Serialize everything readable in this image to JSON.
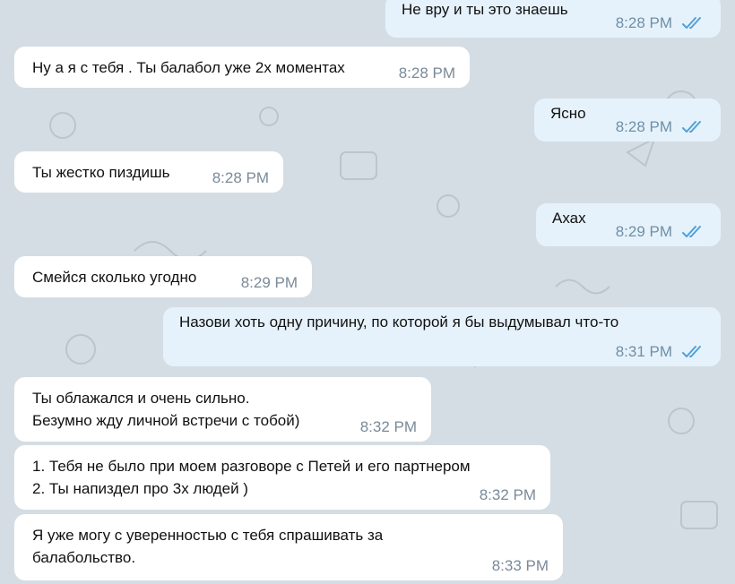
{
  "messages": [
    {
      "side": "out",
      "text": "Не вру и ты это знаешь",
      "time": "8:28 PM",
      "read": true
    },
    {
      "side": "in",
      "text": "Ну а я с тебя . Ты балабол уже 2х моментах",
      "time": "8:28 PM"
    },
    {
      "side": "out",
      "text": "Ясно",
      "time": "8:28 PM",
      "read": true
    },
    {
      "side": "in",
      "text": "Ты жестко пиздишь",
      "time": "8:28 PM"
    },
    {
      "side": "out",
      "text": "Ахах",
      "time": "8:29 PM",
      "read": true
    },
    {
      "side": "in",
      "text": "Смейся сколько угодно",
      "time": "8:29 PM"
    },
    {
      "side": "out",
      "text": "Назови хоть одну причину, по которой я бы выдумывал что-то",
      "time": "8:31 PM",
      "read": true
    },
    {
      "side": "in",
      "text": "Ты облажался и очень сильно.\nБезумно жду личной встречи с тобой)",
      "time": "8:32 PM"
    },
    {
      "side": "in",
      "text": "1. Тебя не было при моем разговоре с Петей и его партнером\n2. Ты напиздел про 3х людей )",
      "time": "8:32 PM"
    },
    {
      "side": "in",
      "text": "Я уже могу с уверенностью с тебя спрашивать за\nбалабольство.",
      "time": "8:33 PM"
    }
  ],
  "icons": {
    "read_receipt": "double-check-icon"
  },
  "colors": {
    "background": "#d4dde3",
    "incoming_bubble": "#ffffff",
    "outgoing_bubble": "#e6f2fb",
    "time": "#7a8a99",
    "check": "#53a0d6"
  }
}
